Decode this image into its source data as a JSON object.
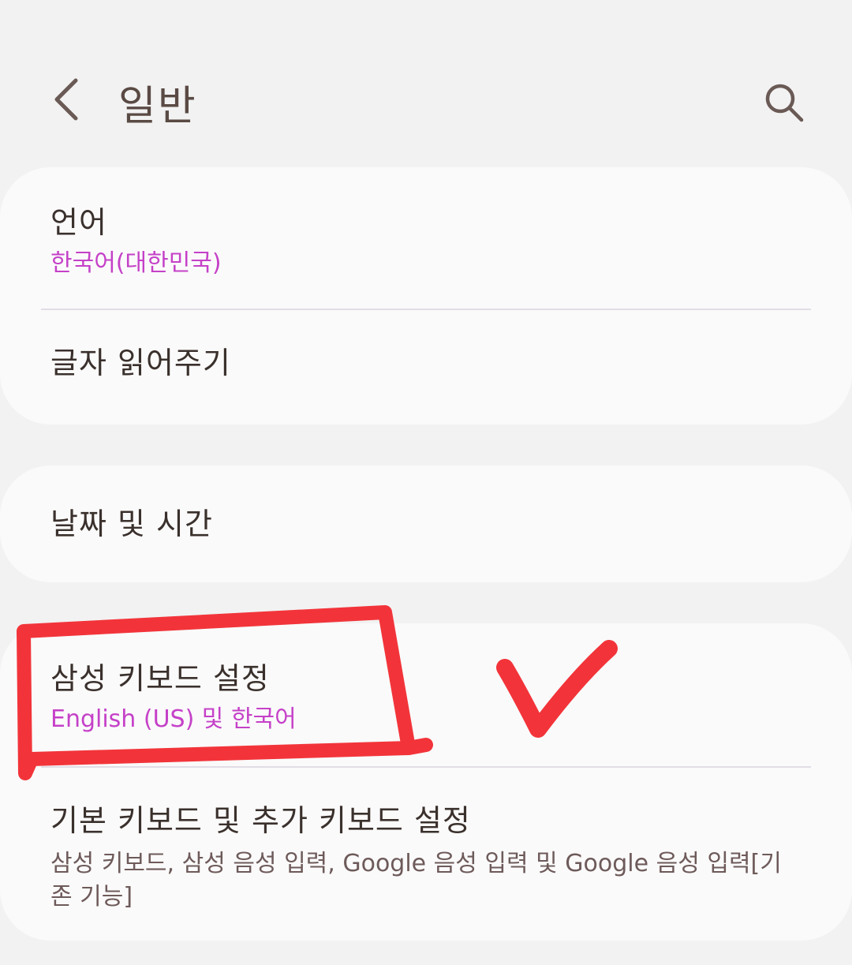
{
  "header": {
    "title": "일반",
    "back_icon": "chevron-left-icon",
    "search_icon": "search-icon"
  },
  "cards": [
    {
      "items": [
        {
          "title": "언어",
          "subtitle": "한국어(대한민국)"
        },
        {
          "title": "글자 읽어주기"
        }
      ]
    },
    {
      "items": [
        {
          "title": "날짜 및 시간"
        }
      ]
    },
    {
      "items": [
        {
          "title": "삼성 키보드 설정",
          "subtitle": "English (US) 및 한국어"
        },
        {
          "title": "기본 키보드 및 추가 키보드 설정",
          "subtitle": "삼성 키보드, 삼성 음성 입력, Google 음성 입력 및 Google 음성 입력[기존 기능]"
        }
      ]
    }
  ],
  "colors": {
    "background": "#f2f2f2",
    "card": "#fafafa",
    "accent_subtitle": "#c541c8",
    "muted_subtitle": "#6e5a5a",
    "annotation": "#f2343a"
  },
  "annotations": {
    "highlight_box": "red-rectangle",
    "check_mark": "red-checkmark"
  }
}
